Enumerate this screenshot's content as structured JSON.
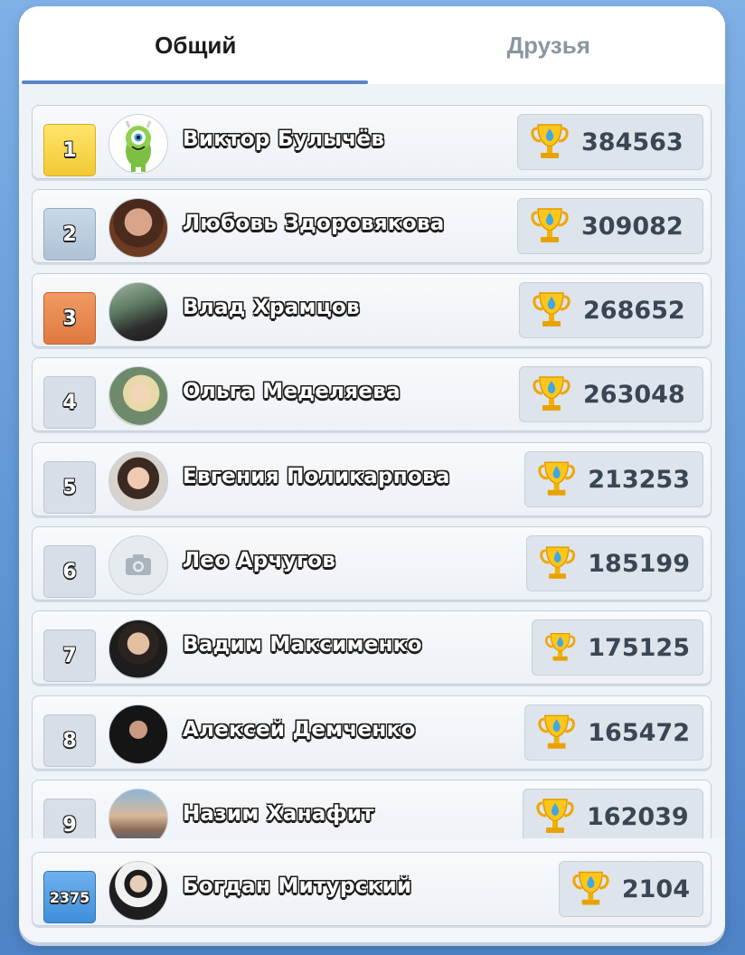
{
  "tabs": {
    "general": "Общий",
    "friends": "Друзья"
  },
  "entries": [
    {
      "rank": "1",
      "name": "Виктор Булычёв",
      "score": "384563",
      "avatar": "monster-avatar"
    },
    {
      "rank": "2",
      "name": "Любовь Здоровякова",
      "score": "309082",
      "avatar": "photo-avatar"
    },
    {
      "rank": "3",
      "name": "Влад Храмцов",
      "score": "268652",
      "avatar": "photo-avatar"
    },
    {
      "rank": "4",
      "name": "Ольга Меделяева",
      "score": "263048",
      "avatar": "photo-avatar"
    },
    {
      "rank": "5",
      "name": "Евгения Поликарпова",
      "score": "213253",
      "avatar": "photo-avatar"
    },
    {
      "rank": "6",
      "name": "Лео Арчугов",
      "score": "185199",
      "avatar": "camera-icon"
    },
    {
      "rank": "7",
      "name": "Вадим Максименко",
      "score": "175125",
      "avatar": "photo-avatar"
    },
    {
      "rank": "8",
      "name": "Алексей Демченко",
      "score": "165472",
      "avatar": "photo-avatar"
    },
    {
      "rank": "9",
      "name": "Назим Ханафит",
      "score": "162039",
      "avatar": "photo-avatar"
    }
  ],
  "me": {
    "rank": "2375",
    "name": "Богдан Митурский",
    "score": "2104",
    "avatar": "photo-avatar"
  },
  "colors": {
    "gold": "#f5cd3d",
    "silver": "#b3c6d9",
    "bronze": "#e5824a",
    "me": "#4a98e0",
    "accent": "#5a86c8"
  }
}
